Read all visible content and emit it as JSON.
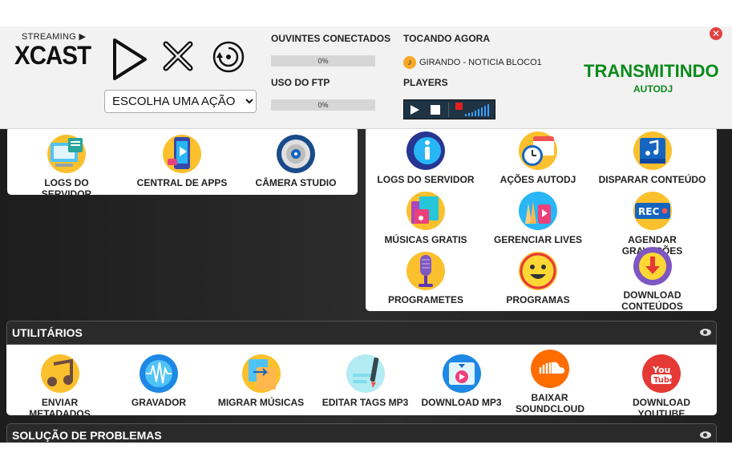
{
  "header": {
    "logo_top": "STREAMING ▶",
    "logo_main": "XCAST",
    "action_select": {
      "selected": "ESCOLHA UMA AÇÃO"
    },
    "listeners_label": "OUVINTES CONECTADOS",
    "listeners_value": "0%",
    "ftp_label": "USO DO FTP",
    "ftp_value": "0%",
    "now_playing_label": "TOCANDO AGORA",
    "now_playing_track": "GIRANDO - NOTICIA BLOCO1",
    "players_label": "PLAYERS",
    "status_main": "TRANSMITINDO",
    "status_sub": "AUTODJ",
    "close_glyph": "✕"
  },
  "colors": {
    "status": "#0a8a1a",
    "close": "#e04040",
    "dark_bg": "#262626"
  },
  "left_panel": {
    "items": [
      {
        "label": "LOGS DO SERVIDOR",
        "icon": "server-logs-icon"
      },
      {
        "label": "CENTRAL DE APPS",
        "icon": "app-center-icon"
      },
      {
        "label": "CÂMERA STUDIO",
        "icon": "camera-studio-icon"
      }
    ]
  },
  "right_panel": {
    "items": [
      {
        "label": "LOGS DO SERVIDOR",
        "icon": "info-icon"
      },
      {
        "label": "AÇÕES AUTODJ",
        "icon": "clock-calendar-icon"
      },
      {
        "label": "DISPARAR CONTEÚDO",
        "icon": "music-note-icon"
      },
      {
        "label": "MÚSICAS GRATIS",
        "icon": "music-library-icon"
      },
      {
        "label": "GERENCIAR LIVES",
        "icon": "live-icon"
      },
      {
        "label": "AGENDAR GRAVAÇÕES",
        "icon": "rec-icon"
      },
      {
        "label": "PROGRAMETES",
        "icon": "microphone-icon"
      },
      {
        "label": "PROGRAMAS",
        "icon": "smiley-icon"
      },
      {
        "label": "DOWNLOAD CONTEÚDOS",
        "icon": "download-icon"
      }
    ]
  },
  "utilities": {
    "title": "UTILITÁRIOS",
    "items": [
      {
        "label": "ENVIAR METADADOS",
        "icon": "metadata-icon"
      },
      {
        "label": "GRAVADOR",
        "icon": "recorder-icon"
      },
      {
        "label": "MIGRAR MÚSICAS",
        "icon": "migrate-icon"
      },
      {
        "label": "EDITAR TAGS MP3",
        "icon": "edit-tags-icon"
      },
      {
        "label": "DOWNLOAD MP3",
        "icon": "download-mp3-icon"
      },
      {
        "label": "BAIXAR SOUNDCLOUD",
        "icon": "soundcloud-icon"
      },
      {
        "label": "DOWNLOAD YOUTUBE",
        "icon": "youtube-icon"
      }
    ]
  },
  "troubleshooting": {
    "title": "SOLUÇÃO DE PROBLEMAS"
  }
}
